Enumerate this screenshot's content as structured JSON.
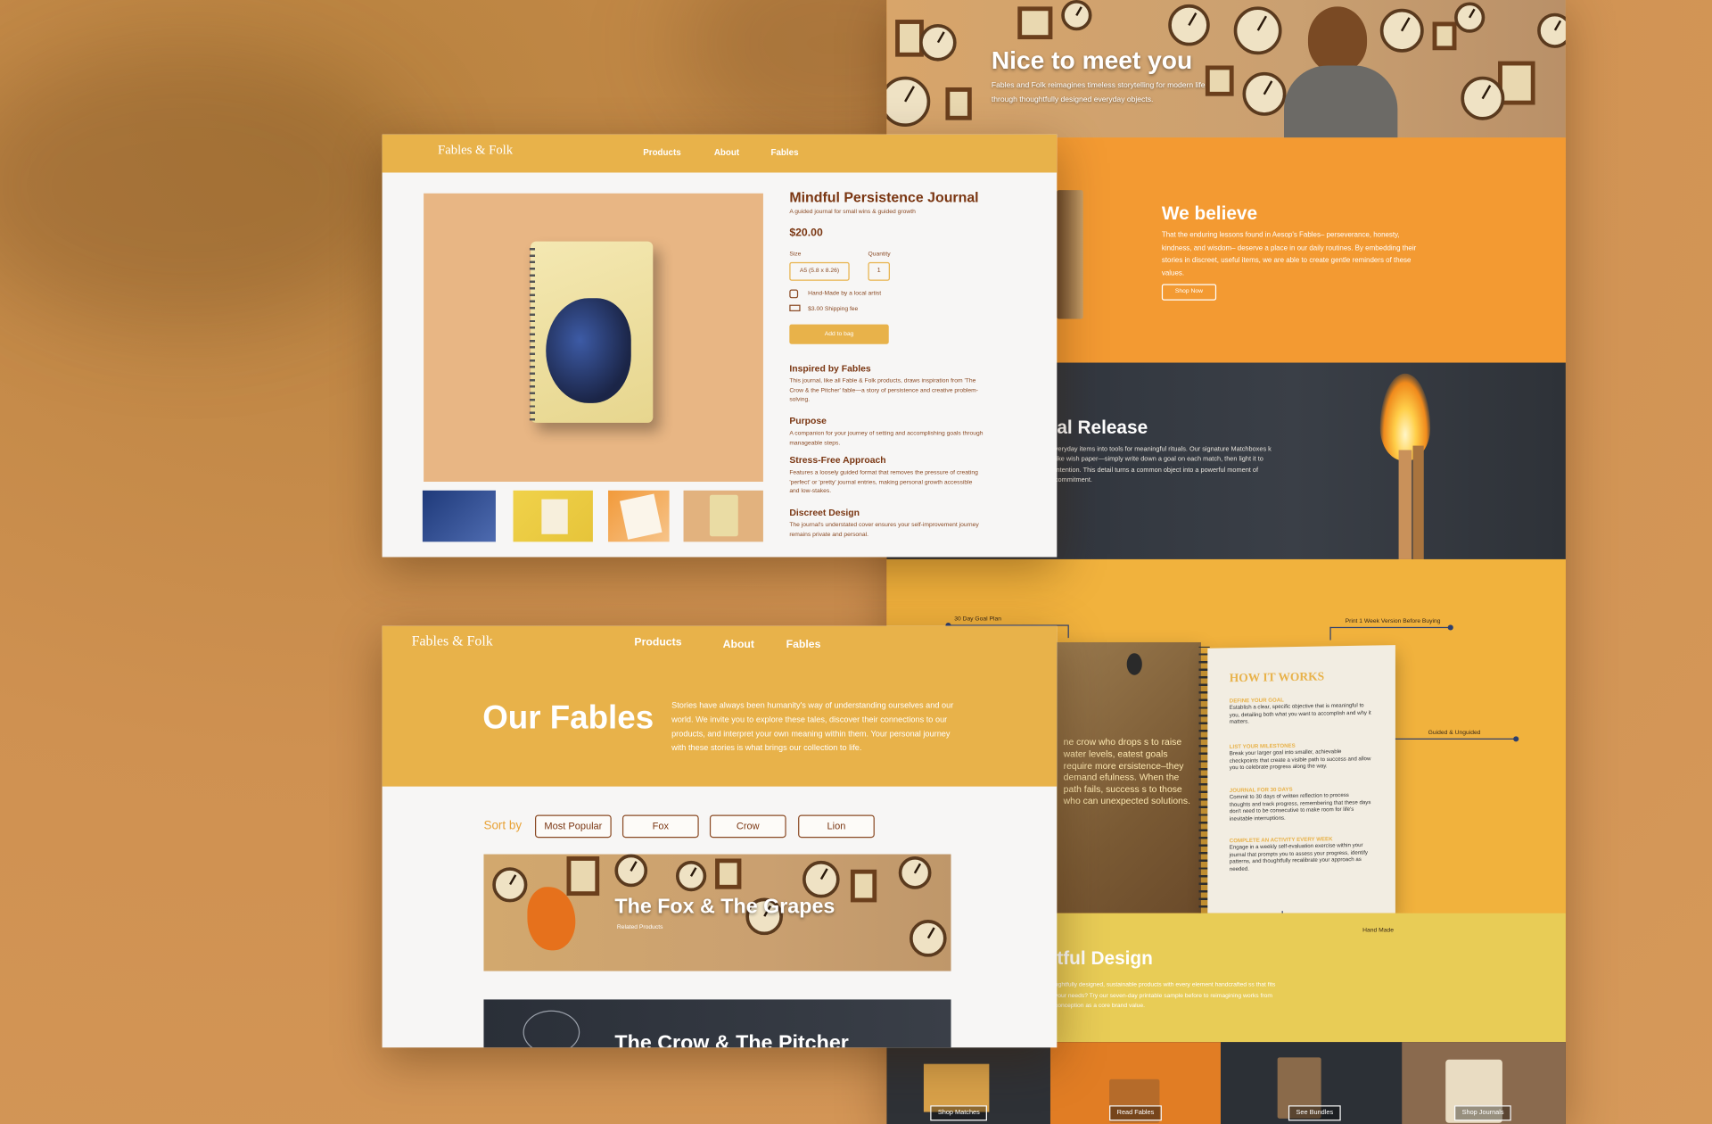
{
  "landing": {
    "hero": {
      "title": "Nice to meet you",
      "text": "Fables and Folk reimagines timeless storytelling for modern life through thoughtfully designed everyday objects."
    },
    "believe": {
      "title": "We believe",
      "text": "That the enduring lessons found in Aesop's Fables– perseverance, honesty, kindness, and wisdom– deserve a place in our daily routines. By embedding their stories in discreet, useful items, we are able to create gentle reminders of these values.",
      "button": "Shop Now"
    },
    "release": {
      "title": "al Release",
      "text": "veryday items into tools for meaningful rituals. Our signature Matchboxes k like wish paper—simply write down a goal on each match, then light it to intention. This detail turns a common object into a powerful moment of commitment."
    },
    "how": {
      "callouts": [
        "30 Day Goal Plan",
        "Print 1 Week Version Before Buying",
        "Guided & Unguided",
        "Hand Made"
      ],
      "page_quote": "ne crow who drops s to raise water levels, eatest goals require more ersistence–they demand efulness. When the path fails, success s to those who can unexpected solutions.",
      "heading": "HOW IT WORKS",
      "steps": [
        {
          "title": "DEFINE YOUR GOAL",
          "text": "Establish a clear, specific objective that is meaningful to you, detailing both what you want to accomplish and why it matters."
        },
        {
          "title": "LIST YOUR MILESTONES",
          "text": "Break your larger goal into smaller, achievable checkpoints that create a visible path to success and allow you to celebrate progress along the way."
        },
        {
          "title": "JOURNAL FOR 30 DAYS",
          "text": "Commit to 30 days of written reflection to process thoughts and track progress, remembering that these days don't need to be consecutive to make room for life's inevitable interruptions."
        },
        {
          "title": "COMPLETE AN ACTIVITY EVERY WEEK",
          "text": "Engage in a weekly self-evaluation exercise within your journal that prompts you to assess your progress, identify patterns, and thoughtfully recalibrate your approach as needed."
        }
      ]
    },
    "design": {
      "title": "tful Design",
      "text": "ughtfully designed, sustainable products with every element handcrafted ss that fits your needs? Try our seven-day printable sample before to reimagining works from conception as a core brand value.",
      "link": "seven-day printable sample"
    },
    "shop": [
      "Shop Matches",
      "Read Fables",
      "See Bundles",
      "Shop Journals"
    ]
  },
  "product_page": {
    "logo": "Fables & Folk",
    "nav": [
      "Products",
      "About",
      "Fables"
    ],
    "title": "Mindful Persistence Journal",
    "subtitle": "A guided journal for small wins & guided growth",
    "price": "$20.00",
    "size_label": "Size",
    "size_value": "A5 (5.8 x 8.26)",
    "quantity_label": "Quantity",
    "quantity_value": "1",
    "handmade": "Hand-Made by a local artist",
    "shipping": "$3.00 Shipping fee",
    "add_to_bag": "Add to bag",
    "sections": [
      {
        "title": "Inspired by Fables",
        "text": "This journal, like all Fable & Folk products, draws inspiration from 'The Crow & the Pitcher' fable—a story of persistence and creative problem-solving."
      },
      {
        "title": "Purpose",
        "text": "A companion for your journey of setting and accomplishing goals through manageable steps."
      },
      {
        "title": "Stress-Free Approach",
        "text": "Features a loosely guided format that removes the pressure of creating 'perfect' or 'pretty' journal entries, making personal growth accessible and low-stakes."
      },
      {
        "title": "Discreet Design",
        "text": "The journal's understated cover ensures your self-improvement journey remains private and personal."
      }
    ]
  },
  "fables_page": {
    "logo": "Fables & Folk",
    "nav": [
      "Products",
      "About",
      "Fables"
    ],
    "title": "Our Fables",
    "intro": "Stories have always been humanity's way of understanding ourselves and our world. We invite you to explore these tales, discover their connections to our products, and interpret your own meaning within them. Your personal journey with these stories is what brings our collection to life.",
    "sort_label": "Sort by",
    "sort_options": [
      "Most Popular",
      "Fox",
      "Crow",
      "Lion"
    ],
    "fables": [
      {
        "title": "The Fox & The Grapes",
        "subtitle": "Related Products"
      },
      {
        "title": "The Crow & The Pitcher"
      }
    ]
  },
  "colors": {
    "mustard": "#e8b24a",
    "orange": "#f39a32",
    "brown": "#7a3612",
    "charcoal": "#2b3038",
    "yellow": "#e8cc56"
  }
}
